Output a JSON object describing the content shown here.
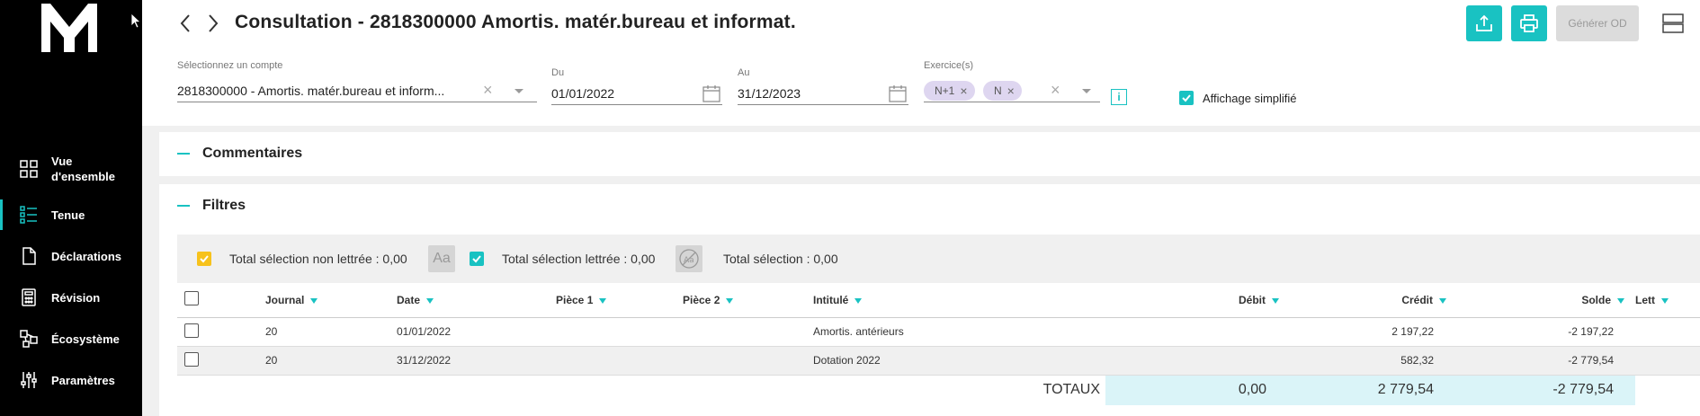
{
  "header": {
    "title": "Consultation - 2818300000 Amortis. matér.bureau et informat.",
    "generate_label": "Générer OD"
  },
  "filters": {
    "account_label": "Sélectionnez un compte",
    "account_value": "2818300000 - Amortis. matér.bureau et inform...",
    "from_label": "Du",
    "from_value": "01/01/2022",
    "to_label": "Au",
    "to_value": "31/12/2023",
    "exercise_label": "Exercice(s)",
    "exercise_chips": [
      "N+1",
      "N"
    ],
    "simplified_label": "Affichage simplifié"
  },
  "sidebar": {
    "items": [
      {
        "label": "Vue d'ensemble",
        "icon": "grid-icon"
      },
      {
        "label": "Tenue",
        "icon": "list-icon"
      },
      {
        "label": "Déclarations",
        "icon": "document-icon"
      },
      {
        "label": "Révision",
        "icon": "calculator-icon"
      },
      {
        "label": "Écosystème",
        "icon": "network-icon"
      },
      {
        "label": "Paramètres",
        "icon": "sliders-icon"
      }
    ]
  },
  "sections": {
    "comments": "Commentaires",
    "filters": "Filtres"
  },
  "summary": {
    "unlettered": "Total sélection non lettrée : 0,00",
    "aa_label": "Aa",
    "lettered": "Total sélection lettrée : 0,00",
    "total": "Total sélection : 0,00"
  },
  "table": {
    "columns": [
      "Journal",
      "Date",
      "Pièce 1",
      "Pièce 2",
      "Intitulé",
      "Débit",
      "Crédit",
      "Solde",
      "Lett"
    ],
    "rows": [
      {
        "journal": "20",
        "date": "01/01/2022",
        "piece1": "",
        "piece2": "",
        "label": "Amortis. antérieurs",
        "debit": "",
        "credit": "2 197,22",
        "solde": "-2 197,22",
        "lett": ""
      },
      {
        "journal": "20",
        "date": "31/12/2022",
        "piece1": "",
        "piece2": "",
        "label": "Dotation 2022",
        "debit": "",
        "credit": "582,32",
        "solde": "-2 779,54",
        "lett": ""
      }
    ],
    "totals": {
      "label": "TOTAUX",
      "debit": "0,00",
      "credit": "2 779,54",
      "solde": "-2 779,54"
    }
  },
  "colors": {
    "accent": "#19c2c2",
    "warning": "#f7c21c",
    "chip": "#ded6f0",
    "totals_bg": "#daf4f8"
  }
}
